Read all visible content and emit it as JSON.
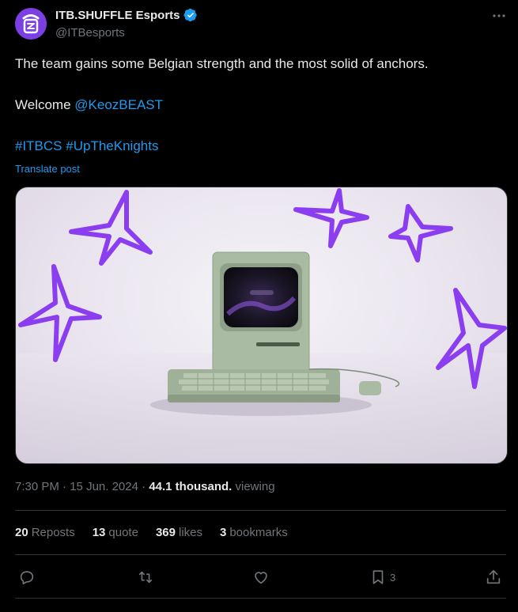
{
  "author": {
    "display_name": "ITB.SHUFFLE Esports",
    "handle": "@ITBesports",
    "verified": true,
    "avatar_icon": "itb-shuffle-logo",
    "avatar_color": "#7b3fe4"
  },
  "tweet": {
    "line1": "The team gains some Belgian strength and the most solid of anchors.",
    "welcome_prefix": "Welcome ",
    "mention": "@KeozBEAST",
    "hashtag1": "#ITBCS",
    "hashtag2": "#UpTheKnights",
    "translate_label": "Translate post"
  },
  "media": {
    "description_icon": "retro-computer-with-purple-sparkles"
  },
  "meta": {
    "time": "7:30 PM",
    "separator": " · ",
    "date": "15 Jun. 2024",
    "views_count": "44.1 thousand.",
    "views_label": " viewing"
  },
  "stats": {
    "reposts_count": "20",
    "reposts_label": "Reposts",
    "quotes_count": "13",
    "quotes_label": "quote",
    "likes_count": "369",
    "likes_label": "likes",
    "bookmarks_count": "3",
    "bookmarks_label": "bookmarks"
  },
  "actions": {
    "bookmark_count": "3"
  },
  "colors": {
    "link": "#1d9bf0",
    "muted": "#71767b",
    "text": "#e7e9ea",
    "sparkle": "#8b3df0"
  }
}
